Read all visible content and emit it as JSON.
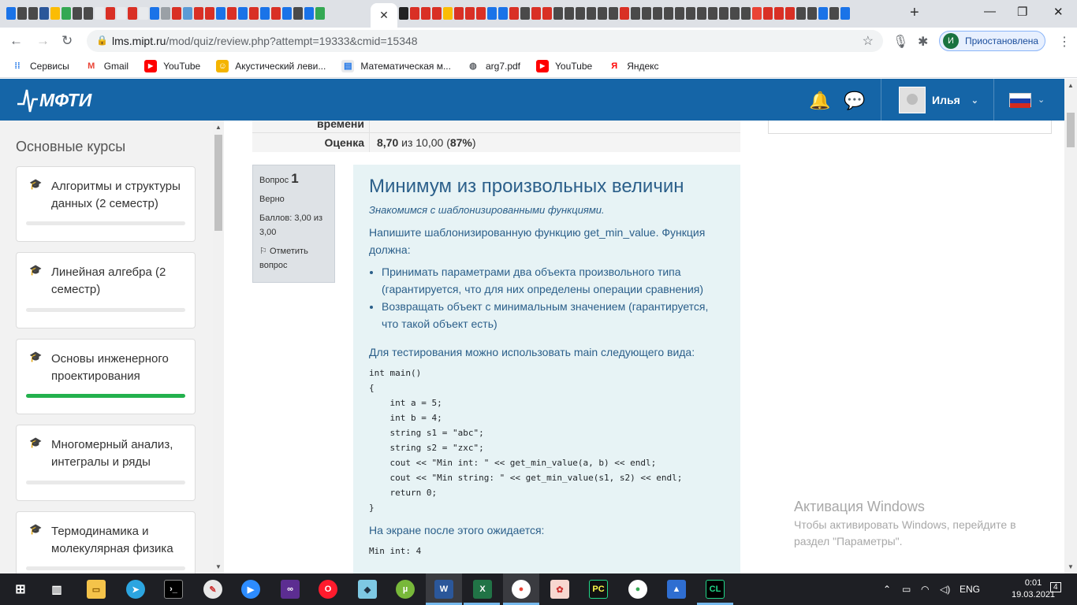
{
  "browser": {
    "url_host": "lms.mipt.ru",
    "url_path": "/mod/quiz/review.php?attempt=19333&cmid=15348",
    "profile_initial": "И",
    "profile_status": "Приостановлена",
    "bookmarks": [
      {
        "label": "Сервисы",
        "icon": "apps-grid-icon"
      },
      {
        "label": "Gmail",
        "icon": "gmail-icon"
      },
      {
        "label": "YouTube",
        "icon": "youtube-icon"
      },
      {
        "label": "Акустический леви...",
        "icon": "bookmark-icon"
      },
      {
        "label": "Математическая м...",
        "icon": "bookmark-icon"
      },
      {
        "label": "arg7.pdf",
        "icon": "globe-icon"
      },
      {
        "label": "YouTube",
        "icon": "youtube-icon"
      },
      {
        "label": "Яндекс",
        "icon": "yandex-icon"
      }
    ]
  },
  "site": {
    "logo": "МФТИ",
    "user_name": "Илья"
  },
  "sidebar": {
    "title": "Основные курсы",
    "courses": [
      {
        "name": "Алгоритмы и структуры данных (2 семестр)",
        "progress": 0
      },
      {
        "name": "Линейная алгебра (2 семестр)",
        "progress": 0
      },
      {
        "name": "Основы инженерного проектирования",
        "progress": 100
      },
      {
        "name": "Многомерный анализ, интегралы и ряды",
        "progress": 0
      },
      {
        "name": "Термодинамика и молекулярная физика",
        "progress": 0
      }
    ]
  },
  "summary": {
    "time_label": "времени",
    "grade_label": "Оценка",
    "grade_score": "8,70",
    "grade_of": "из 10,00 (",
    "grade_percent": "87%",
    "grade_close": ")"
  },
  "question": {
    "label": "Вопрос",
    "number": "1",
    "status": "Верно",
    "points": "Баллов: 3,00 из 3,00",
    "flag_label": "Отметить вопрос",
    "title": "Минимум из произвольных величин",
    "subtitle": "Знакомимся с шаблонизированными функциями.",
    "intro": "Напишите шаблонизированную функцию get_min_value. Функция должна:",
    "bullets": [
      "Принимать параметрами два объекта произвольного типа (гарантируется, что для них определены операции сравнения)",
      "Возвращать объект с минимальным значением (гарантируется, что такой объект есть)"
    ],
    "test_intro": "Для тестирования можно использовать main следующего вида:",
    "code": "int main()\n{\n    int a = 5;\n    int b = 4;\n    string s1 = \"abc\";\n    string s2 = \"zxc\";\n    cout << \"Min int: \" << get_min_value(a, b) << endl;\n    cout << \"Min string: \" << get_min_value(s1, s2) << endl;\n    return 0;\n}",
    "expect_intro": "На экране после этого ожидается:",
    "expect_code": "Min int: 4"
  },
  "activation": {
    "title": "Активация Windows",
    "line1": "Чтобы активировать Windows, перейдите в",
    "line2": "раздел \"Параметры\"."
  },
  "taskbar": {
    "lang": "ENG",
    "time": "0:01",
    "date": "19.03.2021",
    "notifications": "4"
  }
}
